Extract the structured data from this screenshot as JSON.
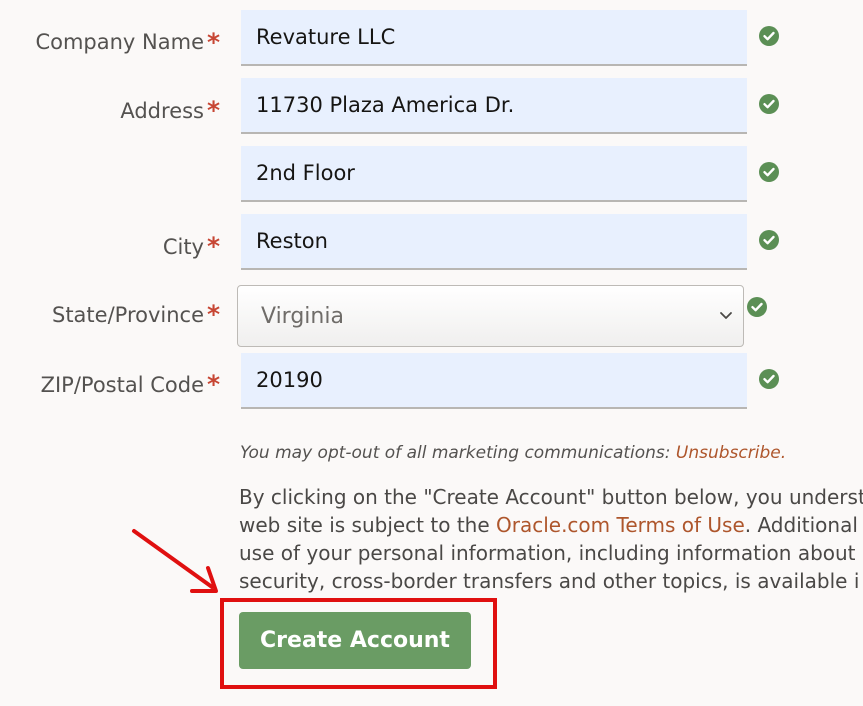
{
  "form": {
    "required_marker": "*",
    "company_name": {
      "label": "Company Name",
      "value": "Revature LLC"
    },
    "address": {
      "label": "Address",
      "value": "11730 Plaza America Dr.",
      "value2": "2nd Floor"
    },
    "city": {
      "label": "City",
      "value": "Reston"
    },
    "state": {
      "label": "State/Province",
      "value": "Virginia"
    },
    "zip": {
      "label": "ZIP/Postal Code",
      "value": "20190"
    }
  },
  "optout": {
    "text": "You may opt-out of all marketing communications: ",
    "link": "Unsubscribe",
    "period": "."
  },
  "legal": {
    "line1": "By clicking on the \"Create Account\" button below, you underst",
    "line2_before": "web site is subject to the ",
    "line2_link": "Oracle.com Terms of Use",
    "line2_after": ". Additional",
    "line3": "use of your personal information, including information about",
    "line4": "security, cross-border transfers and other topics, is available i"
  },
  "create_button": {
    "label": "Create Account"
  },
  "icons": {
    "valid": "check-circle-icon",
    "dropdown": "chevron-down-icon",
    "annotation": "red-arrow"
  },
  "colors": {
    "required": "#c74634",
    "link": "#ae562c",
    "button": "#6a9c64",
    "valid": "#5b8f55",
    "annotation": "#e01010",
    "field_bg": "#e8f0fe"
  }
}
